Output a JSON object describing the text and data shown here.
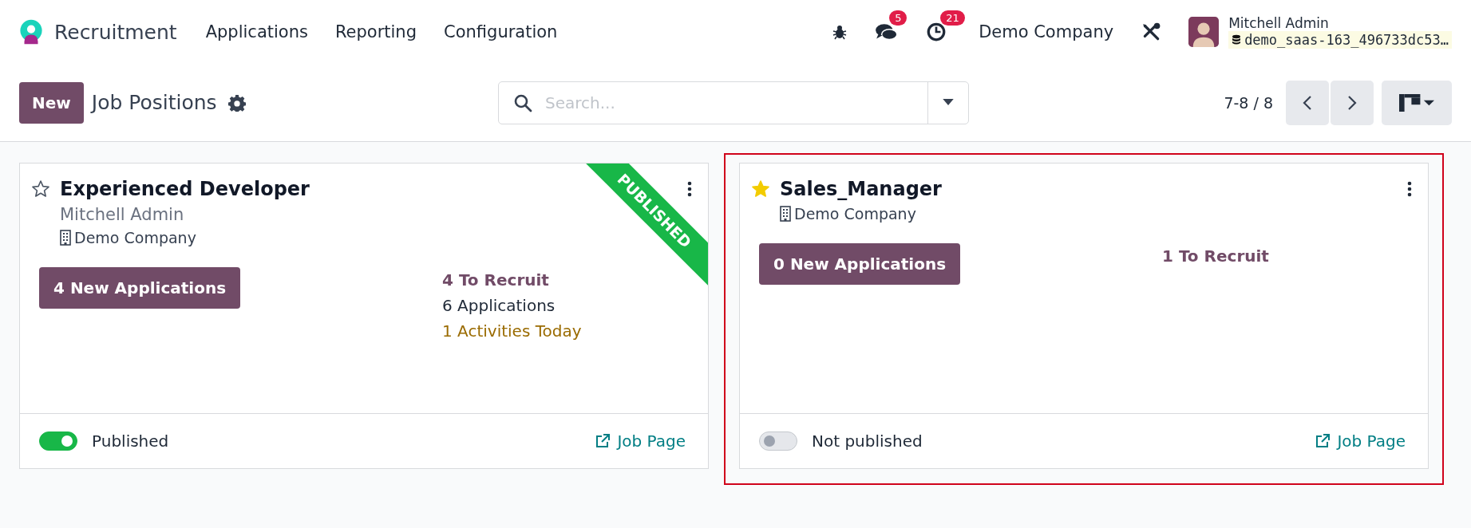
{
  "navbar": {
    "app_name": "Recruitment",
    "menu": [
      "Applications",
      "Reporting",
      "Configuration"
    ],
    "messages_badge": "5",
    "activities_badge": "21",
    "company": "Demo Company",
    "user": {
      "name": "Mitchell Admin",
      "database": "demo_saas-163_496733dc53…"
    }
  },
  "control_panel": {
    "new_button": "New",
    "title": "Job Positions",
    "search": {
      "placeholder": "Search..."
    },
    "pager": "7-8 / 8"
  },
  "cards": [
    {
      "title": "Experienced Developer",
      "favorite": false,
      "highlighted": false,
      "subtitle": "Mitchell Admin",
      "company": "Demo Company",
      "ribbon": "PUBLISHED",
      "new_button": "4 New Applications",
      "stats": [
        {
          "kind": "recruit",
          "text": "4 To Recruit"
        },
        {
          "kind": "count",
          "text": "6 Applications"
        },
        {
          "kind": "activity",
          "text": "1 Activities Today"
        }
      ],
      "published": true,
      "status": "Published",
      "link": "Job Page"
    },
    {
      "title": "Sales_Manager",
      "favorite": true,
      "highlighted": true,
      "company": "Demo Company",
      "new_button": "0 New Applications",
      "stats": [
        {
          "kind": "recruit",
          "text": "1 To Recruit"
        }
      ],
      "published": false,
      "status": "Not published",
      "link": "Job Page"
    }
  ]
}
